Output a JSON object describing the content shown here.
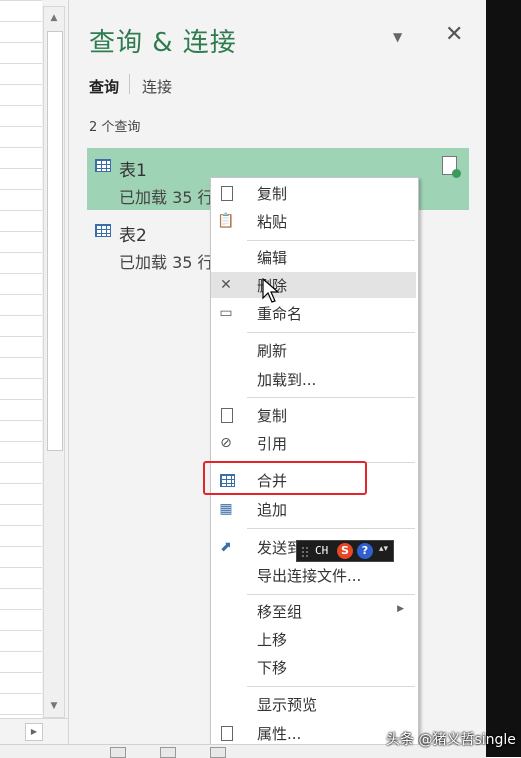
{
  "pane": {
    "title": "查询 & 连接",
    "tabs": [
      "查询",
      "连接"
    ],
    "count": "2 个查询",
    "queries": [
      {
        "name": "表1",
        "status": "已加载 35 行"
      },
      {
        "name": "表2",
        "status": "已加载 35 行"
      }
    ]
  },
  "menu": {
    "items": [
      {
        "label": "复制",
        "icon": "copy-icon"
      },
      {
        "label": "粘贴",
        "icon": "paste-icon"
      },
      {
        "label": "编辑"
      },
      {
        "label": "删除",
        "icon": "delete-icon"
      },
      {
        "label": "重命名",
        "icon": "rename-icon"
      },
      {
        "label": "刷新"
      },
      {
        "label": "加载到..."
      },
      {
        "label": "复制",
        "icon": "duplicate-icon"
      },
      {
        "label": "引用",
        "icon": "reference-icon"
      },
      {
        "label": "合并",
        "icon": "merge-icon"
      },
      {
        "label": "追加",
        "icon": "append-icon"
      },
      {
        "label": "发送到",
        "icon": "send-icon"
      },
      {
        "label": "导出连接文件..."
      },
      {
        "label": "移至组"
      },
      {
        "label": "上移"
      },
      {
        "label": "下移"
      },
      {
        "label": "显示预览"
      },
      {
        "label": "属性...",
        "icon": "properties-icon"
      }
    ]
  },
  "ime": {
    "lang": "CH",
    "s": "S",
    "help": "?"
  },
  "watermark": "头条 @猪义哲single",
  "colors": {
    "accent": "#2e7c4f",
    "selected": "#9fd3b6",
    "highlight": "#e0262a"
  }
}
